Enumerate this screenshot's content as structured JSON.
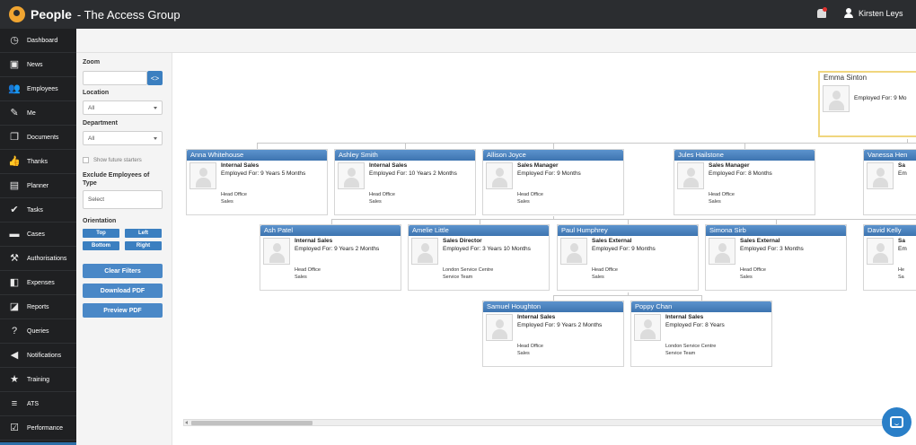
{
  "app": {
    "name": "People",
    "subtitle": "- The Access Group"
  },
  "user": {
    "name": "Kirsten Leys"
  },
  "nav": [
    {
      "label": "Dashboard",
      "icon": "dashboard-icon",
      "glyph": "◷"
    },
    {
      "label": "News",
      "icon": "tv-icon",
      "glyph": "▣"
    },
    {
      "label": "Employees",
      "icon": "users-icon",
      "glyph": "👥"
    },
    {
      "label": "Me",
      "icon": "user-edit-icon",
      "glyph": "✎"
    },
    {
      "label": "Documents",
      "icon": "documents-icon",
      "glyph": "❐"
    },
    {
      "label": "Thanks",
      "icon": "thumbs-up-icon",
      "glyph": "👍"
    },
    {
      "label": "Planner",
      "icon": "planner-icon",
      "glyph": "▤"
    },
    {
      "label": "Tasks",
      "icon": "check-icon",
      "glyph": "✔"
    },
    {
      "label": "Cases",
      "icon": "folder-icon",
      "glyph": "▬"
    },
    {
      "label": "Authorisations",
      "icon": "gavel-icon",
      "glyph": "⚒"
    },
    {
      "label": "Expenses",
      "icon": "wallet-icon",
      "glyph": "◧"
    },
    {
      "label": "Reports",
      "icon": "chart-icon",
      "glyph": "◪"
    },
    {
      "label": "Queries",
      "icon": "query-icon",
      "glyph": "?"
    },
    {
      "label": "Notifications",
      "icon": "megaphone-icon",
      "glyph": "◀"
    },
    {
      "label": "Training",
      "icon": "star-icon",
      "glyph": "★"
    },
    {
      "label": "ATS",
      "icon": "ats-icon",
      "glyph": "≡"
    },
    {
      "label": "Performance",
      "icon": "checkbox-icon",
      "glyph": "☑"
    }
  ],
  "filters": {
    "zoom_label": "Zoom",
    "zoom_button": "<>",
    "location_label": "Location",
    "location_value": "All",
    "department_label": "Department",
    "department_value": "All",
    "future_starters": "Show future starters",
    "exclude_label": "Exclude Employees of Type",
    "exclude_placeholder": "Select",
    "orientation_label": "Orientation",
    "orient_top": "Top",
    "orient_left": "Left",
    "orient_bottom": "Bottom",
    "orient_right": "Right",
    "clear": "Clear Filters",
    "download": "Download PDF",
    "preview": "Preview PDF"
  },
  "org": {
    "root": {
      "name": "Emma Sinton",
      "employed": "Employed For: 9 Mo"
    },
    "level1": [
      {
        "name": "Anna Whitehouse",
        "title": "Internal Sales",
        "employed": "Employed For: 9 Years 5 Months",
        "location": "Head Office",
        "department": "Sales"
      },
      {
        "name": "Ashley Smith",
        "title": "Internal Sales",
        "employed": "Employed For: 10 Years 2 Months",
        "location": "Head Office",
        "department": "Sales"
      },
      {
        "name": "Allison Joyce",
        "title": "Sales Manager",
        "employed": "Employed For: 9 Months",
        "location": "Head Office",
        "department": "Sales"
      },
      {
        "name": "Jules Hailstone",
        "title": "Sales Manager",
        "employed": "Employed For: 8 Months",
        "location": "Head Office",
        "department": "Sales"
      },
      {
        "name": "Vanessa Hen",
        "title": "Sa",
        "employed": "Em",
        "location": "",
        "department": ""
      }
    ],
    "level2": [
      {
        "name": "Ash Patel",
        "title": "Internal Sales",
        "employed": "Employed For: 9 Years 2 Months",
        "location": "Head Office",
        "department": "Sales"
      },
      {
        "name": "Amelie Little",
        "title": "Sales Director",
        "employed": "Employed For: 3 Years 10 Months",
        "location": "London Service Centre",
        "department": "Service Team"
      },
      {
        "name": "Paul Humphrey",
        "title": "Sales External",
        "employed": "Employed For: 9 Months",
        "location": "Head Office",
        "department": "Sales"
      },
      {
        "name": "Simona Sirb",
        "title": "Sales External",
        "employed": "Employed For: 3 Months",
        "location": "Head Office",
        "department": "Sales"
      },
      {
        "name": "David Kelly",
        "title": "Sa",
        "employed": "Em",
        "location": "He",
        "department": "Sa"
      }
    ],
    "level3": [
      {
        "name": "Samuel Houghton",
        "title": "Internal Sales",
        "employed": "Employed For: 9 Years 2 Months",
        "location": "Head Office",
        "department": "Sales"
      },
      {
        "name": "Poppy Chan",
        "title": "Internal Sales",
        "employed": "Employed For: 8 Years",
        "location": "London Service Centre",
        "department": "Service Team"
      }
    ]
  },
  "colors": {
    "topbar": "#2b2d30",
    "sidebar": "#1f2022",
    "accent": "#3b7fc0",
    "card_header": "#4a82bf",
    "selected_border": "#f0d67e"
  }
}
